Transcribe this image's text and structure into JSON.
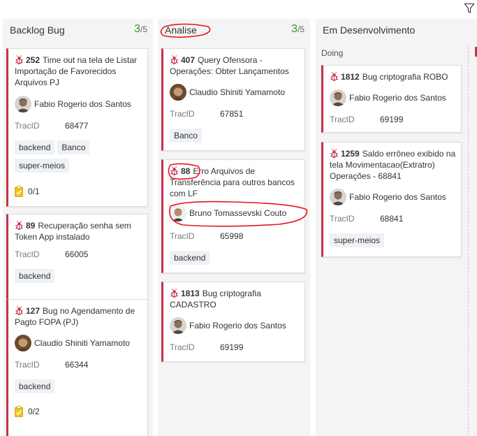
{
  "columns": {
    "backlog": {
      "title": "Backlog Bug",
      "count": "3",
      "limit": "/5"
    },
    "analise": {
      "title": "Analise",
      "count": "3",
      "limit": "/5"
    },
    "dev": {
      "title": "Em Desenvolvimento",
      "swimlane": "Doing"
    }
  },
  "field_label": "TracID",
  "cards": [
    {
      "id": "252",
      "title": "Time out na tela de Listar Importação de Favorecidos Arquivos PJ",
      "assignee": "Fabio Rogerio dos Santos",
      "tracid": "68477",
      "tags": [
        "backend",
        "Banco",
        "super-meios"
      ],
      "checklist": "0/1"
    },
    {
      "id": "89",
      "title": "Recuperação senha sem Token App instalado",
      "tracid": "66005",
      "tags": [
        "backend"
      ]
    },
    {
      "id": "127",
      "title": "Bug no Agendamento de Pagto FOPA (PJ)",
      "assignee": "Claudio Shiniti Yamamoto",
      "tracid": "66344",
      "tags": [
        "backend"
      ],
      "checklist": "0/2"
    },
    {
      "id": "407",
      "title": "Query Ofensora - Operações: Obter Lançamentos",
      "assignee": "Claudio Shiniti Yamamoto",
      "tracid": "67851",
      "tags": [
        "Banco"
      ]
    },
    {
      "id": "88",
      "title": "Erro Arquivos de Transferência para outros bancos com LF",
      "assignee": "Bruno Tomassevski Couto",
      "tracid": "65998",
      "tags": [
        "backend"
      ]
    },
    {
      "id": "1813",
      "title": "Bug criptografia CADASTRO",
      "assignee": "Fabio Rogerio dos Santos",
      "tracid": "69199",
      "tags": []
    },
    {
      "id": "1812",
      "title": "Bug criptografia ROBO",
      "assignee": "Fabio Rogerio dos Santos",
      "tracid": "69199",
      "tags": []
    },
    {
      "id": "1259",
      "title": "Saldo errôneo exibido na tela Movimentacao(Extratro) Operações  - 68841",
      "assignee": "Fabio Rogerio dos Santos",
      "tracid": "68841",
      "tags": [
        "super-meios"
      ]
    }
  ],
  "icons": {
    "filter": "filter-icon",
    "bug": "bug-icon",
    "checklist": "checklist-icon",
    "avatar": "avatar"
  },
  "colors": {
    "accent": "#c4314b",
    "count": "#339933",
    "annotation": "#e8141d",
    "tag_bg": "#eef1f5"
  }
}
